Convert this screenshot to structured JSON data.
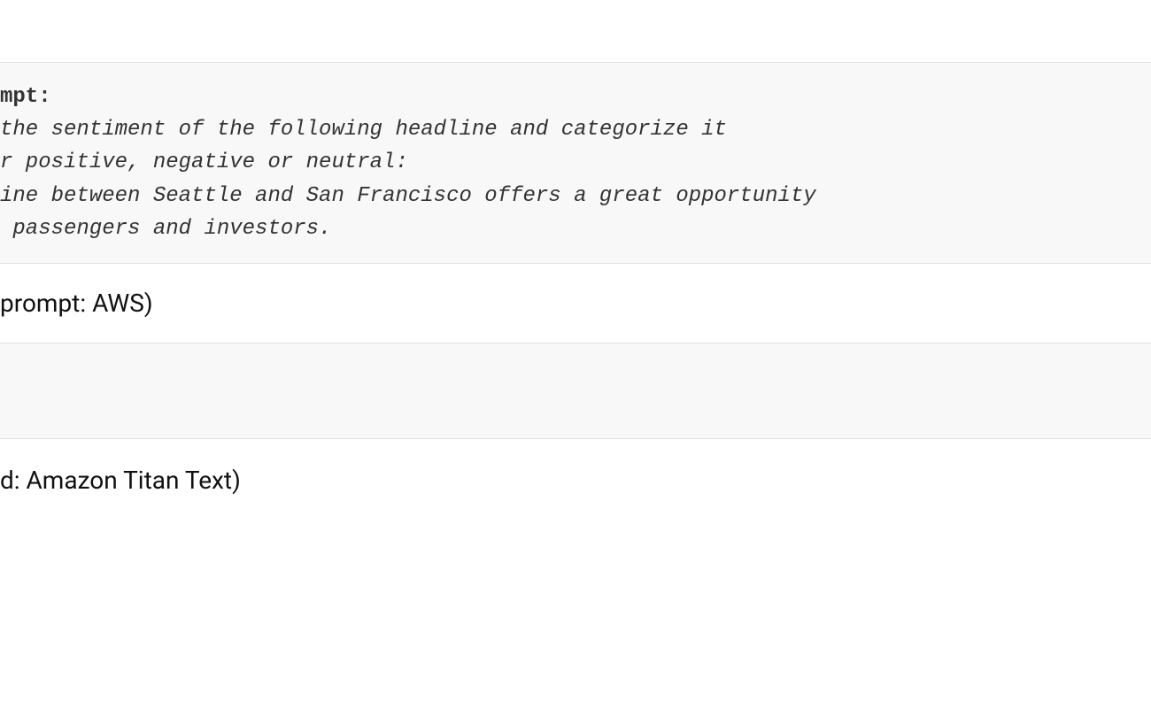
{
  "code": {
    "line1_bold": "mpt:",
    "line2_italic": "the sentiment of the following headline and categorize it",
    "line3_italic": "r positive, negative or neutral:",
    "line4_italic": "ine between Seattle and San Francisco offers a great opportunity",
    "line5_italic": " passengers and investors."
  },
  "caption1": " prompt: AWS)",
  "caption2": "d: Amazon Titan Text)"
}
